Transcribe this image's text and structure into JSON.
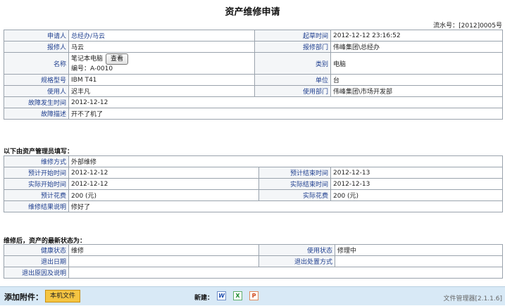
{
  "header": {
    "title": "资产维修申请",
    "serial_label": "流水号：",
    "serial_value": "[2012]0005号"
  },
  "basic": {
    "applicant_label": "申请人",
    "applicant_value": "总经办/马云",
    "draft_time_label": "起草时间",
    "draft_time_value": "2012-12-12 23:16:52",
    "reporter_label": "报修人",
    "reporter_value": "马云",
    "report_dept_label": "报修部门",
    "report_dept_value": "伟峰集团\\总经办",
    "name_label": "名称",
    "name_value": "笔记本电脑",
    "view_button": "查看",
    "code_value": "编号：A-0010",
    "category_label": "类别",
    "category_value": "电脑",
    "model_label": "规格型号",
    "model_value": "IBM T41",
    "unit_label": "单位",
    "unit_value": "台",
    "user_label": "使用人",
    "user_value": "迟丰凡",
    "use_dept_label": "使用部门",
    "use_dept_value": "伟峰集团\\市场开发部",
    "fault_time_label": "故障发生时间",
    "fault_time_value": "2012-12-12",
    "fault_desc_label": "故障描述",
    "fault_desc_value": "开不了机了"
  },
  "admin": {
    "section_title": "以下由资产管理员填写：",
    "method_label": "维修方式",
    "method_value": "外部维修",
    "plan_start_label": "预计开始时间",
    "plan_start_value": "2012-12-12",
    "plan_end_label": "预计结束时间",
    "plan_end_value": "2012-12-13",
    "actual_start_label": "实际开始时间",
    "actual_start_value": "2012-12-12",
    "actual_end_label": "实际结束时间",
    "actual_end_value": "2012-12-13",
    "plan_cost_label": "预计花费",
    "plan_cost_value": "200 (元)",
    "actual_cost_label": "实际花费",
    "actual_cost_value": "200 (元)",
    "result_label": "维修结果说明",
    "result_value": "修好了"
  },
  "status": {
    "section_title": "维修后，资产的最新状态为：",
    "health_label": "健康状态",
    "health_value": "维修",
    "use_status_label": "使用状态",
    "use_status_value": "修理中",
    "exit_date_label": "退出日期",
    "exit_date_value": "",
    "exit_method_label": "退出处置方式",
    "exit_method_value": "",
    "exit_reason_label": "退出原因及说明",
    "exit_reason_value": ""
  },
  "footer": {
    "attach_label": "添加附件：",
    "local_file_button": "本机文件",
    "new_label": "新建：",
    "icons": [
      "word-icon",
      "excel-icon",
      "powerpoint-icon"
    ],
    "file_manager": "文件管理器[2.1.1.6]"
  }
}
